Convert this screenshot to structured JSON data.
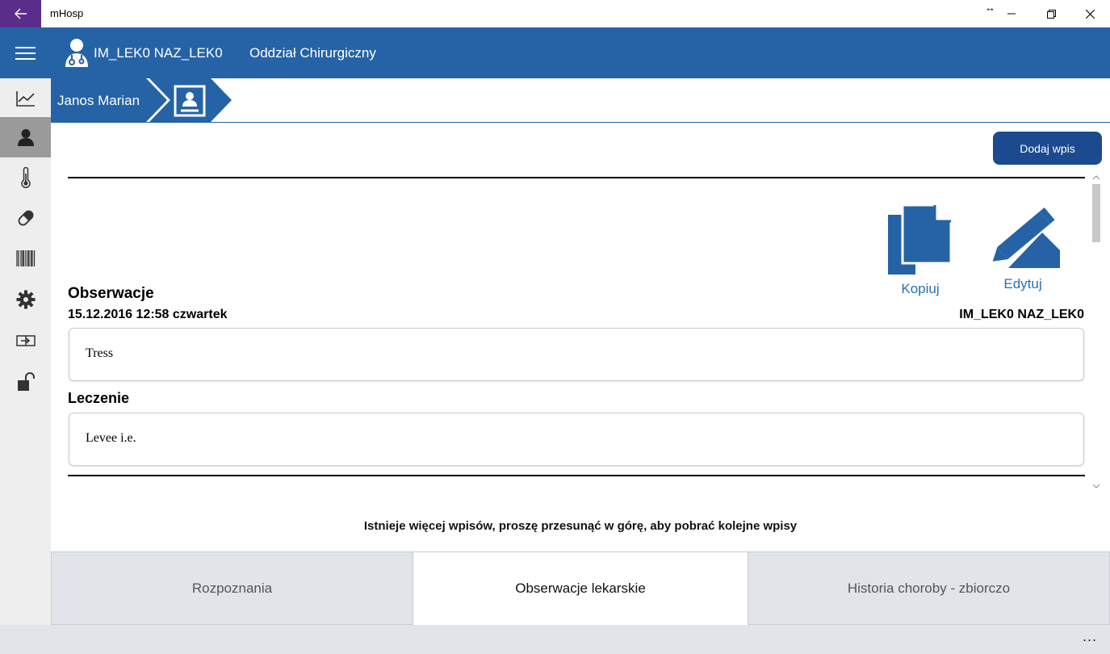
{
  "window": {
    "title": "mHosp",
    "back_icon": "arrow-left-icon",
    "resize_indicator": "↔",
    "minimize_icon": "minimize-icon",
    "restore_icon": "restore-icon",
    "close_icon": "close-icon"
  },
  "header": {
    "doctor_name": "IM_LEK0 NAZ_LEK0",
    "department": "Oddział Chirurgiczny",
    "accent_color": "#2563a6"
  },
  "sidebar": {
    "items": [
      {
        "icon": "chart-icon",
        "active": false
      },
      {
        "icon": "patient-icon",
        "active": true
      },
      {
        "icon": "thermometer-icon",
        "active": false
      },
      {
        "icon": "pill-icon",
        "active": false
      },
      {
        "icon": "barcode-icon",
        "active": false
      },
      {
        "icon": "gear-icon",
        "active": false
      },
      {
        "icon": "switch-icon",
        "active": false
      },
      {
        "icon": "unlock-icon",
        "active": false
      }
    ]
  },
  "breadcrumb": {
    "patient": "Janos Marian",
    "card_icon": "patient-card-icon"
  },
  "toolbar": {
    "add_entry": "Dodaj wpis"
  },
  "entry": {
    "copy_label": "Kopiuj",
    "edit_label": "Edytuj",
    "observations_title": "Obserwacje",
    "date": "15.12.2016 12:58 czwartek",
    "author": "IM_LEK0 NAZ_LEK0",
    "observations_text": "Tress",
    "treatment_title": "Leczenie",
    "treatment_text": "Levee i.e."
  },
  "more_hint": "Istnieje więcej wpisów, proszę przesunąć w górę, aby pobrać kolejne wpisy",
  "tabs": [
    {
      "label": "Rozpoznania",
      "active": false
    },
    {
      "label": "Obserwacje lekarskie",
      "active": true
    },
    {
      "label": "Historia choroby - zbiorczo",
      "active": false
    }
  ],
  "appbar": {
    "more": "..."
  }
}
